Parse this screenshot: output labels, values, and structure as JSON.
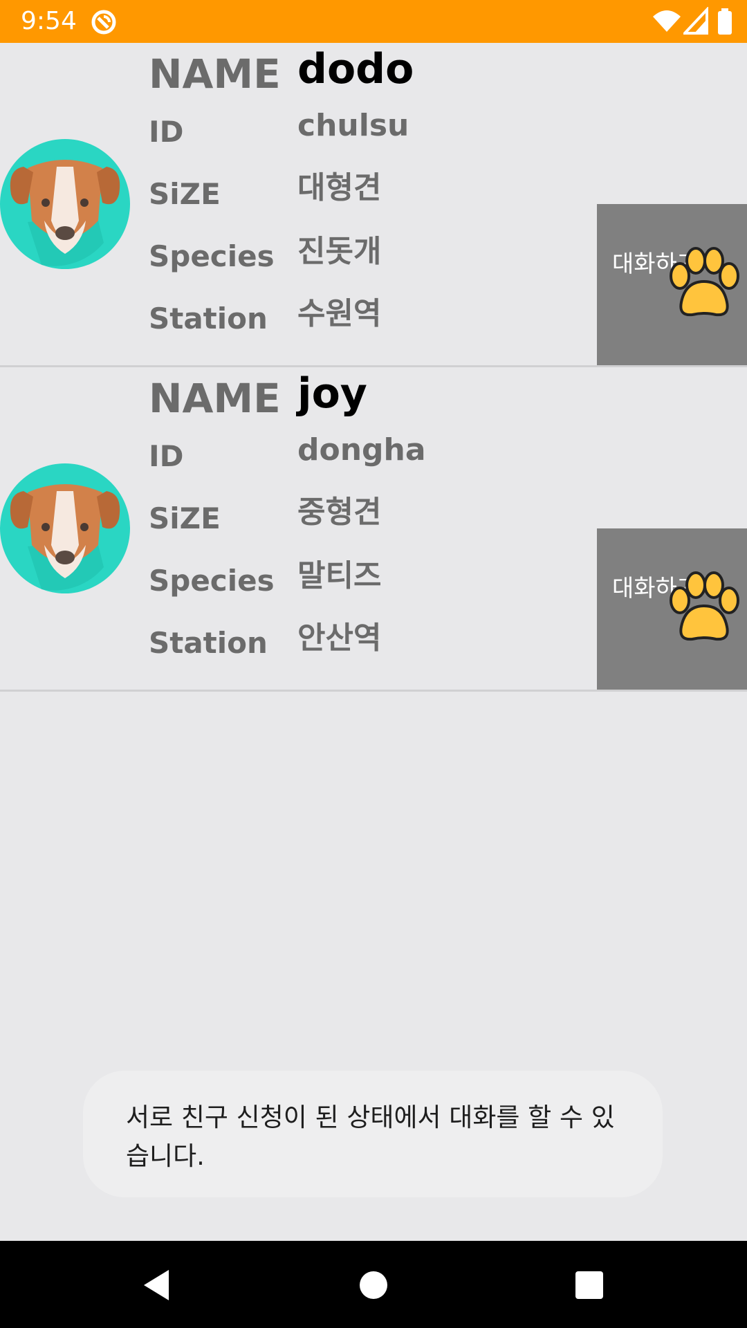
{
  "status_bar": {
    "time": "9:54",
    "icons": [
      "sync-icon",
      "wifi-icon",
      "signal-icon",
      "battery-icon"
    ]
  },
  "users": [
    {
      "labels": {
        "name": "NAME",
        "id": "ID",
        "size": "SiZE",
        "species": "Species",
        "station": "Station"
      },
      "name": "dodo",
      "id": "chulsu",
      "size": "대형견",
      "species": "진돗개",
      "station": "수원역",
      "chat_button": "대화하기",
      "avatar_icon": "dog-avatar-icon",
      "paw_icon": "paw-icon"
    },
    {
      "labels": {
        "name": "NAME",
        "id": "ID",
        "size": "SiZE",
        "species": "Species",
        "station": "Station"
      },
      "name": "joy",
      "id": "dongha",
      "size": "중형견",
      "species": "말티즈",
      "station": "안산역",
      "chat_button": "대화하기",
      "avatar_icon": "dog-avatar-icon",
      "paw_icon": "paw-icon"
    }
  ],
  "toast": {
    "message": "서로 친구 신청이 된 상태에서 대화를 할 수 있습니다."
  },
  "nav_bar": {
    "buttons": [
      "back-icon",
      "home-icon",
      "recents-icon"
    ]
  },
  "colors": {
    "status_bar": "#ff9800",
    "background": "#e8e8ea",
    "chat_button": "#808080",
    "avatar_bg": "#2ad6c3",
    "paw": "#ffc43d",
    "nav_bar": "#000000"
  }
}
